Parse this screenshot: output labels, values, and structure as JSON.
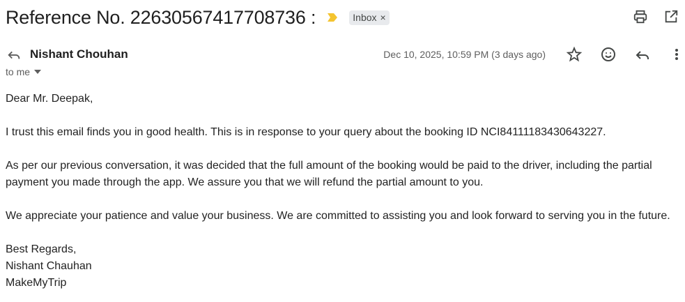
{
  "email": {
    "subject": "Reference No. 22630567417708736 :",
    "label": "Inbox",
    "label_remove": "×",
    "sender": "Nishant Chouhan",
    "date": "Dec 10, 2025, 10:59 PM (3 days ago)",
    "recipient": "to me",
    "body": {
      "greeting": "Dear Mr. Deepak,",
      "para1": "I trust this email finds you in good health. This is in response to your query about the booking ID NCI84111183430643227.",
      "para2": "As per our previous conversation, it was decided that the full amount of the booking would be paid to the driver, including the partial payment you made through the app. We assure you that we will refund the partial amount to you.",
      "para3": "We appreciate your patience and value your business. We are committed to assisting you and look forward to serving you in the future.",
      "closing": "Best Regards,",
      "signature_name": "Nishant Chauhan",
      "signature_company": "MakeMyTrip"
    }
  },
  "icons": {
    "importance": "importance-marker-icon",
    "print": "print-icon",
    "open_new_window": "open-in-new-window-icon",
    "sender_reply": "reply-arrow-icon",
    "star": "star-icon",
    "emoji": "emoji-reaction-icon",
    "reply": "reply-icon",
    "more": "more-vertical-icon",
    "dropdown": "dropdown-arrow-icon"
  },
  "colors": {
    "importance_marker": "#f4c430",
    "chip_bg": "#e8eaed",
    "icon_color": "#444746",
    "text_secondary": "#5e5e5e"
  }
}
